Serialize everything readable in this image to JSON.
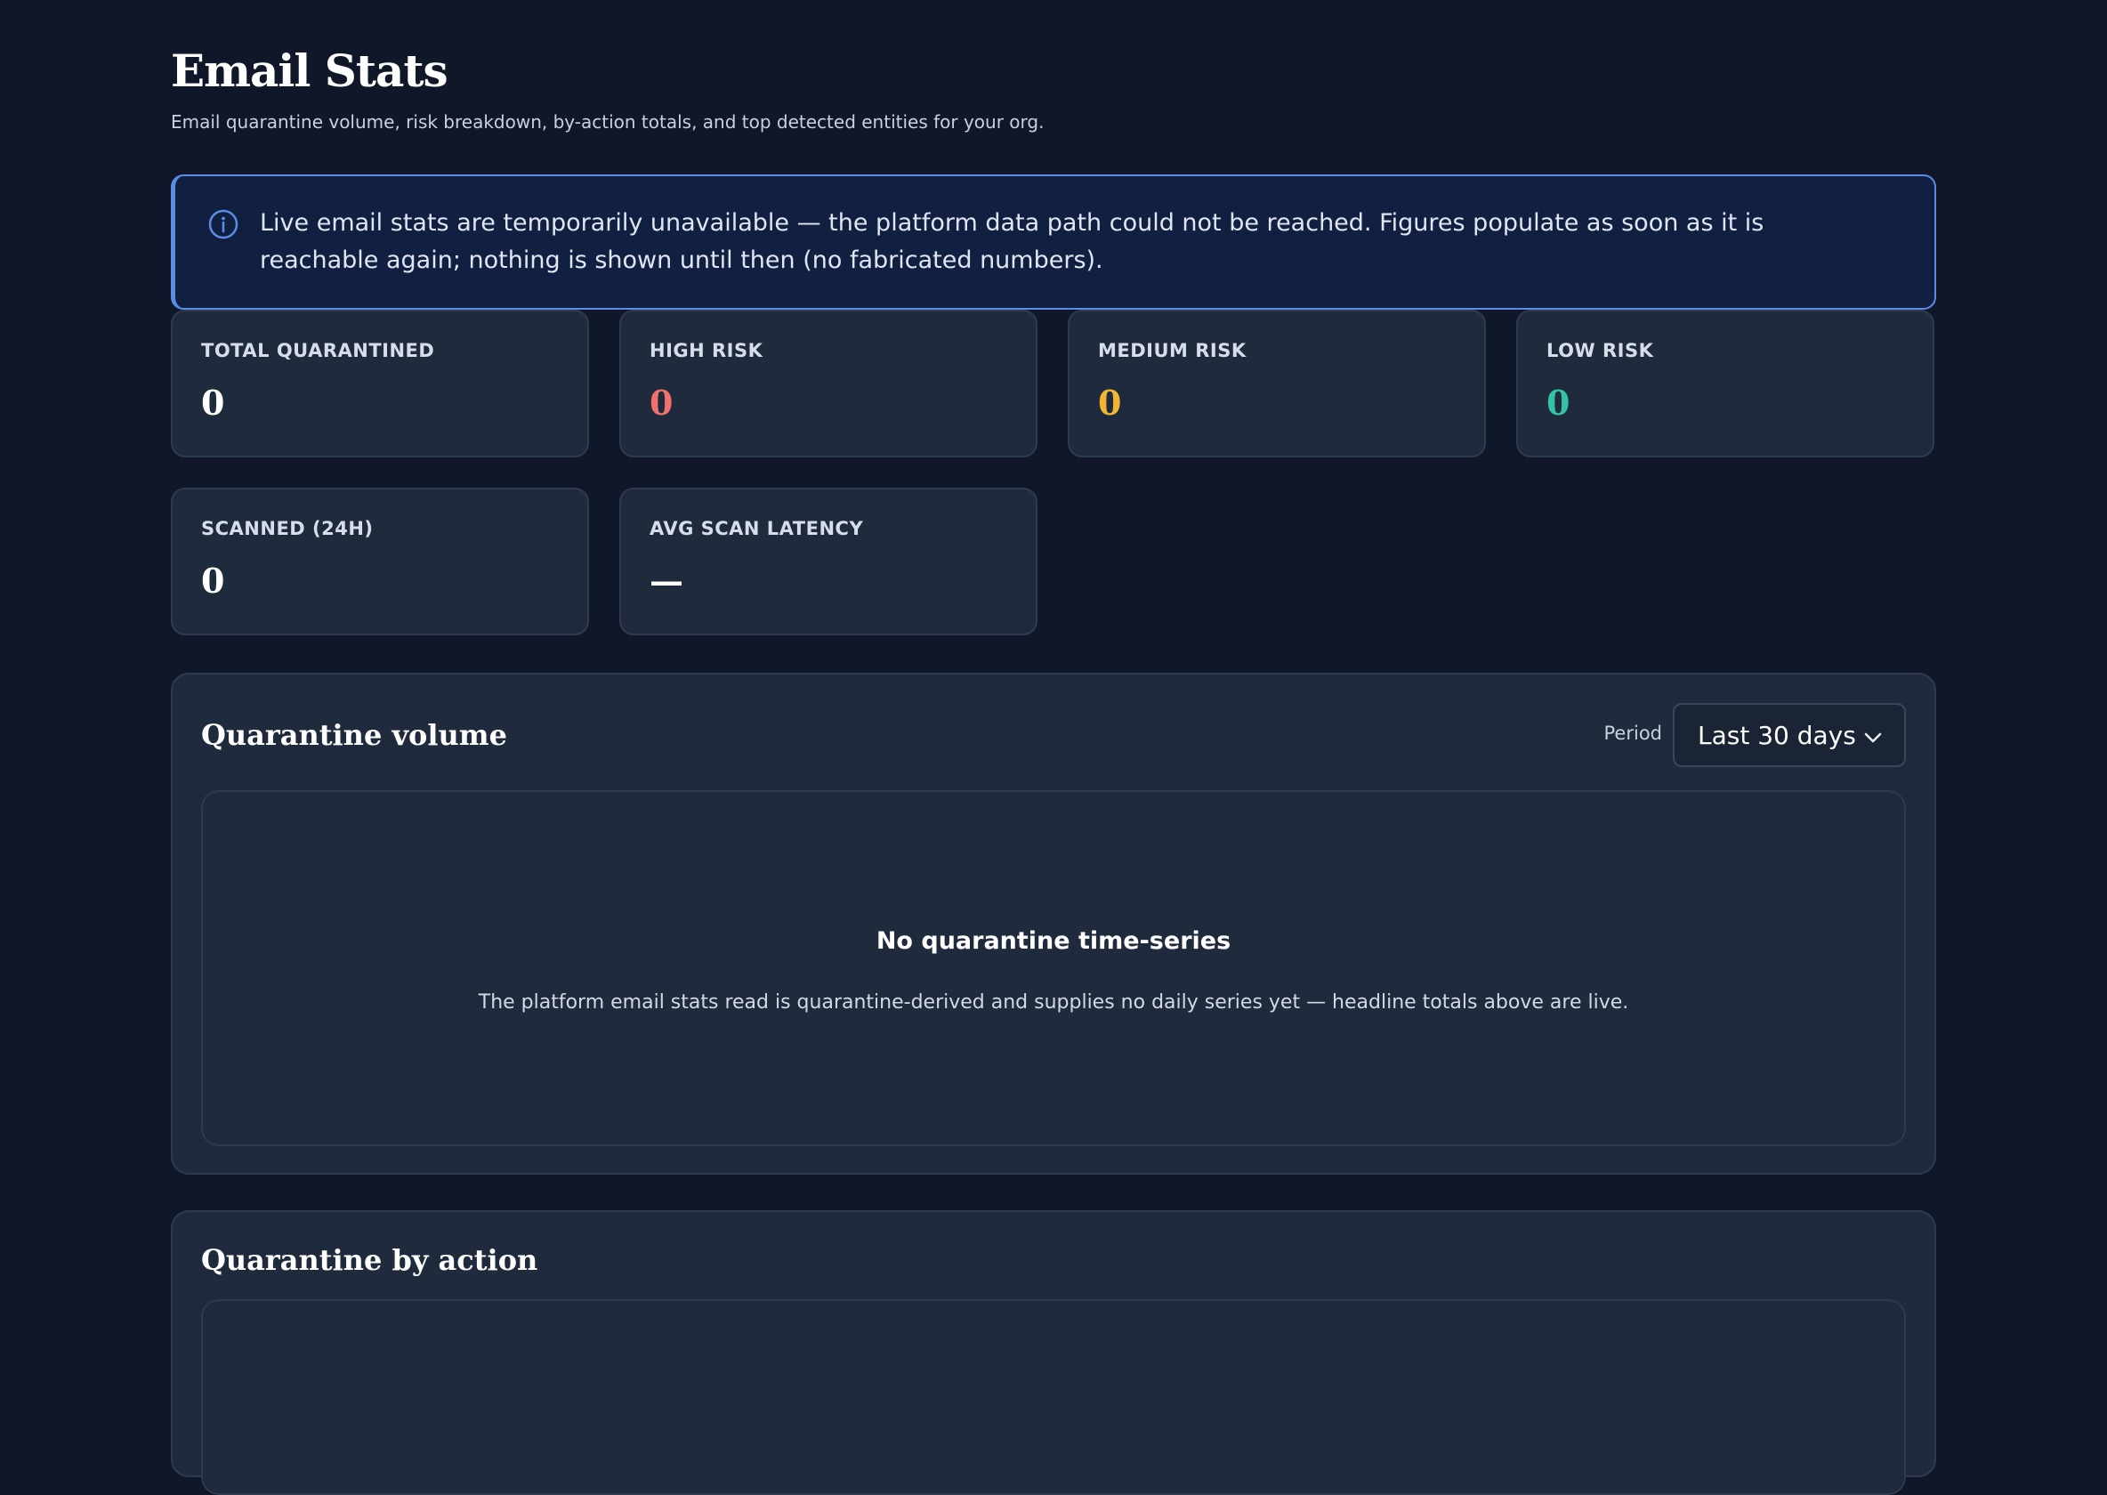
{
  "header": {
    "title": "Email Stats",
    "subtitle": "Email quarantine volume, risk breakdown, by-action totals, and top detected entities for your org."
  },
  "alert": {
    "icon": "info-circle-icon",
    "message": "Live email stats are temporarily unavailable — the platform data path could not be reached. Figures populate as soon as it is reachable again; nothing is shown until then (no fabricated numbers)."
  },
  "stats": {
    "total_quarantined": {
      "label": "TOTAL QUARANTINED",
      "value": "0",
      "color": "#ffffff"
    },
    "high_risk": {
      "label": "HIGH RISK",
      "value": "0",
      "color": "#f0716d"
    },
    "medium_risk": {
      "label": "MEDIUM RISK",
      "value": "0",
      "color": "#f2b532"
    },
    "low_risk": {
      "label": "LOW RISK",
      "value": "0",
      "color": "#34c2a2"
    },
    "scanned_24h": {
      "label": "SCANNED (24H)",
      "value": "0",
      "color": "#ffffff"
    },
    "avg_scan_latency": {
      "label": "AVG SCAN LATENCY",
      "value": "—",
      "color": "#ffffff"
    }
  },
  "quarantine_volume": {
    "title": "Quarantine volume",
    "period_label": "Period",
    "period_value": "Last 30 days",
    "empty_title": "No quarantine time-series",
    "empty_desc": "The platform email stats read is quarantine-derived and supplies no daily series yet — headline totals above are live."
  },
  "quarantine_by_action": {
    "title": "Quarantine by action"
  },
  "colors": {
    "background": "#0f1729",
    "card": "#1f2a3c",
    "alert_border": "#5b8ce6"
  }
}
